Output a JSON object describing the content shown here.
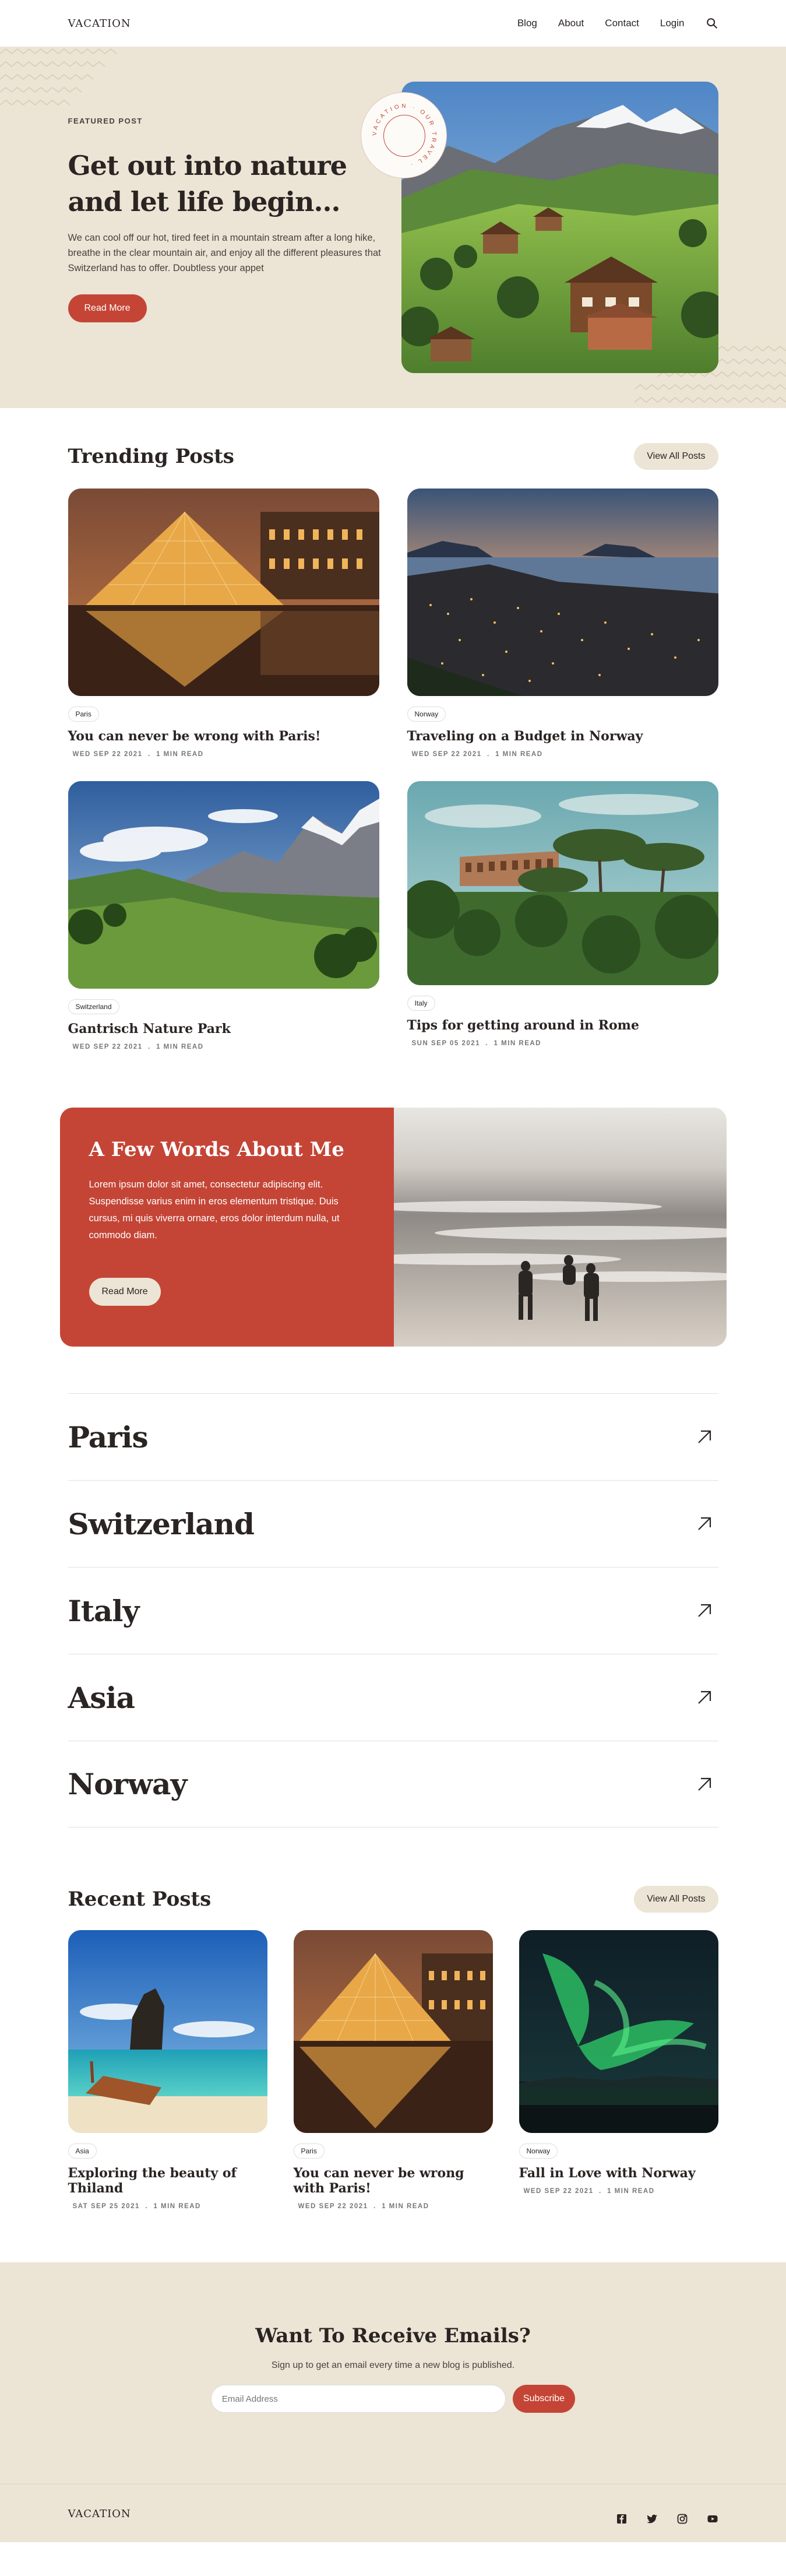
{
  "nav": {
    "logo": "VACATION",
    "links": [
      "Blog",
      "About",
      "Contact",
      "Login"
    ],
    "icons": {
      "search": "search-icon"
    }
  },
  "hero": {
    "eyebrow": "FEATURED POST",
    "title": "Get out into nature and let life begin...",
    "text": "We can cool off our hot, tired feet in a mountain stream after a long hike, breathe in the clear mountain air, and enjoy all the different pleasures that Switzerland has to offer. Doubtless your appet",
    "button": "Read More",
    "stamp_text": "VACATION · OUR TRAVEL ·"
  },
  "trending": {
    "title": "Trending Posts",
    "view_all": "View All Posts",
    "posts": [
      {
        "tag": "Paris",
        "title": "You can never be wrong with Paris!",
        "date": "WED SEP 22 2021",
        "read": "1 MIN READ"
      },
      {
        "tag": "Norway",
        "title": "Traveling on a Budget in Norway",
        "date": "WED SEP 22 2021",
        "read": "1 MIN READ"
      },
      {
        "tag": "Switzerland",
        "title": "Gantrisch Nature Park",
        "date": "WED SEP 22 2021",
        "read": "1 MIN READ"
      },
      {
        "tag": "Italy",
        "title": "Tips for getting around in Rome",
        "date": "SUN SEP 05 2021",
        "read": "1 MIN READ"
      }
    ]
  },
  "about": {
    "title": "A Few Words About Me",
    "text": "Lorem ipsum dolor sit amet, consectetur adipiscing elit. Suspendisse varius enim in eros elementum tristique. Duis cursus, mi quis viverra ornare, eros dolor interdum nulla, ut commodo diam.",
    "button": "Read More"
  },
  "categories": [
    "Paris",
    "Switzerland",
    "Italy",
    "Asia",
    "Norway"
  ],
  "recent": {
    "title": "Recent Posts",
    "view_all": "View All Posts",
    "posts": [
      {
        "tag": "Asia",
        "title": "Exploring the beauty of Thiland",
        "date": "SAT SEP 25 2021",
        "read": "1 MIN READ"
      },
      {
        "tag": "Paris",
        "title": "You can never be wrong with Paris!",
        "date": "WED SEP 22 2021",
        "read": "1 MIN READ"
      },
      {
        "tag": "Norway",
        "title": "Fall in Love with Norway",
        "date": "WED SEP 22 2021",
        "read": "1 MIN READ"
      }
    ]
  },
  "newsletter": {
    "title": "Want To Receive Emails?",
    "subtitle": "Sign up to get an email every time a new blog is published.",
    "placeholder": "Email Address",
    "button": "Subscribe"
  },
  "footer": {
    "logo": "VACATION",
    "socials": [
      "facebook-icon",
      "twitter-icon",
      "instagram-icon",
      "youtube-icon"
    ]
  },
  "colors": {
    "accent": "#c44536",
    "cream": "#ece4d5",
    "text": "#2a2422"
  }
}
